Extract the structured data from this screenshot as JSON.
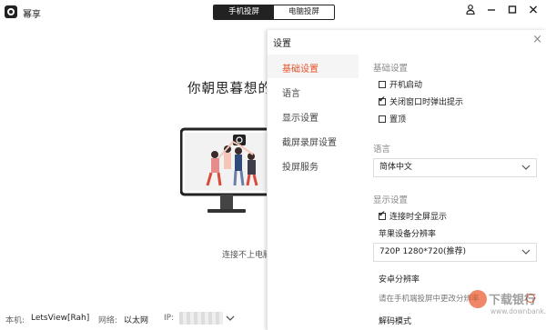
{
  "app": {
    "title": "幂享"
  },
  "tabs": [
    {
      "label": "手机投屏",
      "active": true
    },
    {
      "label": "电脑投屏",
      "active": false
    }
  ],
  "window_icons": [
    "user-icon",
    "minimize-icon",
    "maximize-icon",
    "close-icon"
  ],
  "main": {
    "title": "你朝思暮想的朋",
    "connect_text": "连接不上电脑"
  },
  "statusbar": {
    "device_label": "本机:",
    "device_value": "LetsView[Rah]",
    "network_label": "网络:",
    "network_value": "以太网",
    "ip_label": "IP:"
  },
  "settings": {
    "title": "设置",
    "close_glyph": "×",
    "sidebar": [
      {
        "label": "基础设置",
        "active": true
      },
      {
        "label": "语言",
        "active": false
      },
      {
        "label": "显示设置",
        "active": false
      },
      {
        "label": "截屏录屏设置",
        "active": false
      },
      {
        "label": "投屏服务",
        "active": false
      }
    ],
    "basic": {
      "heading": "基础设置",
      "options": [
        {
          "label": "开机启动",
          "checked": false
        },
        {
          "label": "关闭窗口时弹出提示",
          "checked": true
        },
        {
          "label": "置顶",
          "checked": false
        }
      ]
    },
    "language": {
      "heading": "语言",
      "value": "简体中文"
    },
    "display": {
      "heading": "显示设置",
      "fullscreen_label": "连接时全屏显示",
      "fullscreen_checked": true,
      "apple_res_label": "苹果设备分辨率",
      "apple_res_value": "720P 1280*720(推荐)",
      "android_res_label": "安卓分辨率",
      "android_hint": "请在手机端投屏中更改分辨率",
      "decode_label": "解码模式"
    }
  },
  "watermark": {
    "text": "下载银行",
    "url": "www.downbank.cn"
  },
  "colors": {
    "accent": "#e8542a",
    "dark": "#222222"
  }
}
